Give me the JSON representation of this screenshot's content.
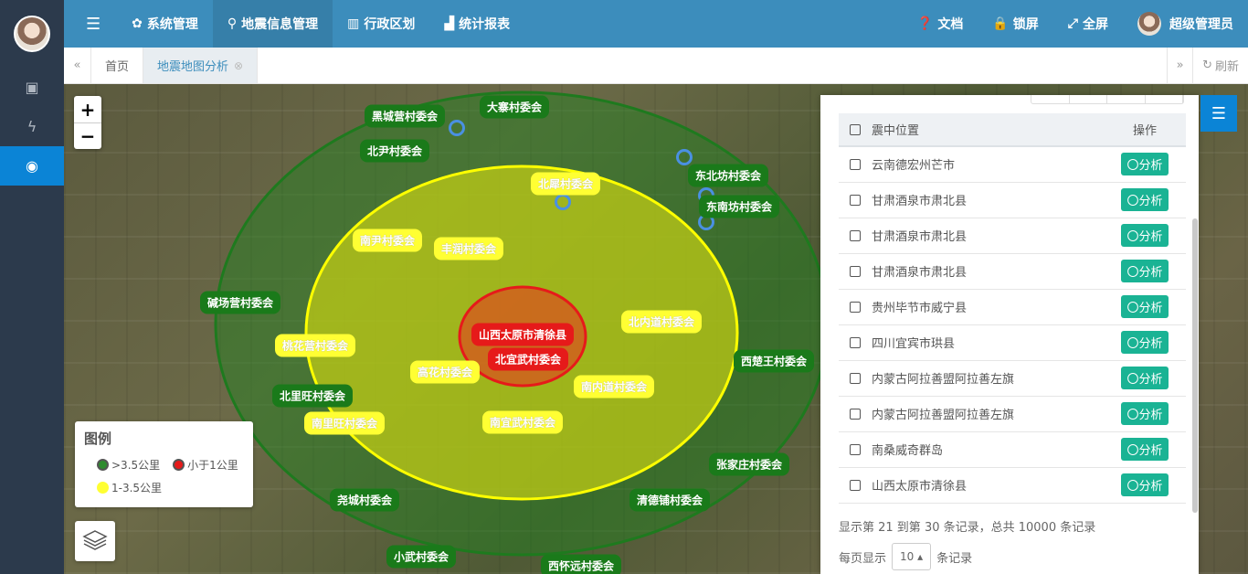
{
  "sidebar": {
    "items": [
      {
        "icon": "money-icon",
        "glyph": "▣"
      },
      {
        "icon": "bolt-icon",
        "glyph": "ϟ"
      },
      {
        "icon": "target-icon",
        "glyph": "◉"
      }
    ]
  },
  "header": {
    "menu": [
      {
        "icon": "gear-icon",
        "glyph": "✿",
        "label": "系统管理"
      },
      {
        "icon": "map-pin-icon",
        "glyph": "⚲",
        "label": "地震信息管理"
      },
      {
        "icon": "bank-icon",
        "glyph": "▥",
        "label": "行政区划"
      },
      {
        "icon": "chart-icon",
        "glyph": "▟",
        "label": "统计报表"
      }
    ],
    "right": [
      {
        "icon": "question-icon",
        "glyph": "❓",
        "label": "文档"
      },
      {
        "icon": "lock-icon",
        "glyph": "🔒",
        "label": "锁屏"
      },
      {
        "icon": "fullscreen-icon",
        "glyph": "⤢",
        "label": "全屏"
      }
    ],
    "user": "超级管理员"
  },
  "tabs": {
    "home": "首页",
    "active": "地震地图分析",
    "refresh": "刷新"
  },
  "legend": {
    "title": "图例",
    "items": [
      {
        "label": ">3.5公里",
        "color": "#2e8b2e"
      },
      {
        "label": "小于1公里",
        "color": "#e61a1a"
      },
      {
        "label": "1-3.5公里",
        "color": "#ffff33"
      }
    ]
  },
  "map_labels": [
    {
      "text": "黑城营村委会",
      "tier": "green"
    },
    {
      "text": "大寨村委会",
      "tier": "green"
    },
    {
      "text": "北尹村委会",
      "tier": "green"
    },
    {
      "text": "北犀村委会",
      "tier": "yellow"
    },
    {
      "text": "东北坊村委会",
      "tier": "green"
    },
    {
      "text": "东南坊村委会",
      "tier": "green"
    },
    {
      "text": "南尹村委会",
      "tier": "yellow"
    },
    {
      "text": "丰润村委会",
      "tier": "yellow"
    },
    {
      "text": "碱场营村委会",
      "tier": "green"
    },
    {
      "text": "北内道村委会",
      "tier": "yellow"
    },
    {
      "text": "山西太原市清徐县",
      "tier": "red"
    },
    {
      "text": "北宜武村委会",
      "tier": "red"
    },
    {
      "text": "桃花营村委会",
      "tier": "yellow"
    },
    {
      "text": "西楚王村委会",
      "tier": "green"
    },
    {
      "text": "高花村委会",
      "tier": "yellow"
    },
    {
      "text": "南内道村委会",
      "tier": "yellow"
    },
    {
      "text": "北里旺村委会",
      "tier": "green"
    },
    {
      "text": "南里旺村委会",
      "tier": "yellow"
    },
    {
      "text": "南宜武村委会",
      "tier": "yellow"
    },
    {
      "text": "张家庄村委会",
      "tier": "green"
    },
    {
      "text": "尧城村委会",
      "tier": "green"
    },
    {
      "text": "清德铺村委会",
      "tier": "green"
    },
    {
      "text": "小武村委会",
      "tier": "green"
    },
    {
      "text": "西怀远村委会",
      "tier": "green"
    }
  ],
  "table": {
    "col_location": "震中位置",
    "col_action": "操作",
    "action_label": "〇分析",
    "rows": [
      "云南德宏州芒市",
      "甘肃酒泉市肃北县",
      "甘肃酒泉市肃北县",
      "甘肃酒泉市肃北县",
      "贵州毕节市威宁县",
      "四川宜宾市珙县",
      "内蒙古阿拉善盟阿拉善左旗",
      "内蒙古阿拉善盟阿拉善左旗",
      "南桑威奇群岛",
      "山西太原市清徐县"
    ],
    "pagination_info": "显示第 21 到第 30 条记录，总共 10000 条记录",
    "page_size_prefix": "每页显示",
    "page_size": "10 ▴",
    "page_size_suffix": "条记录"
  }
}
